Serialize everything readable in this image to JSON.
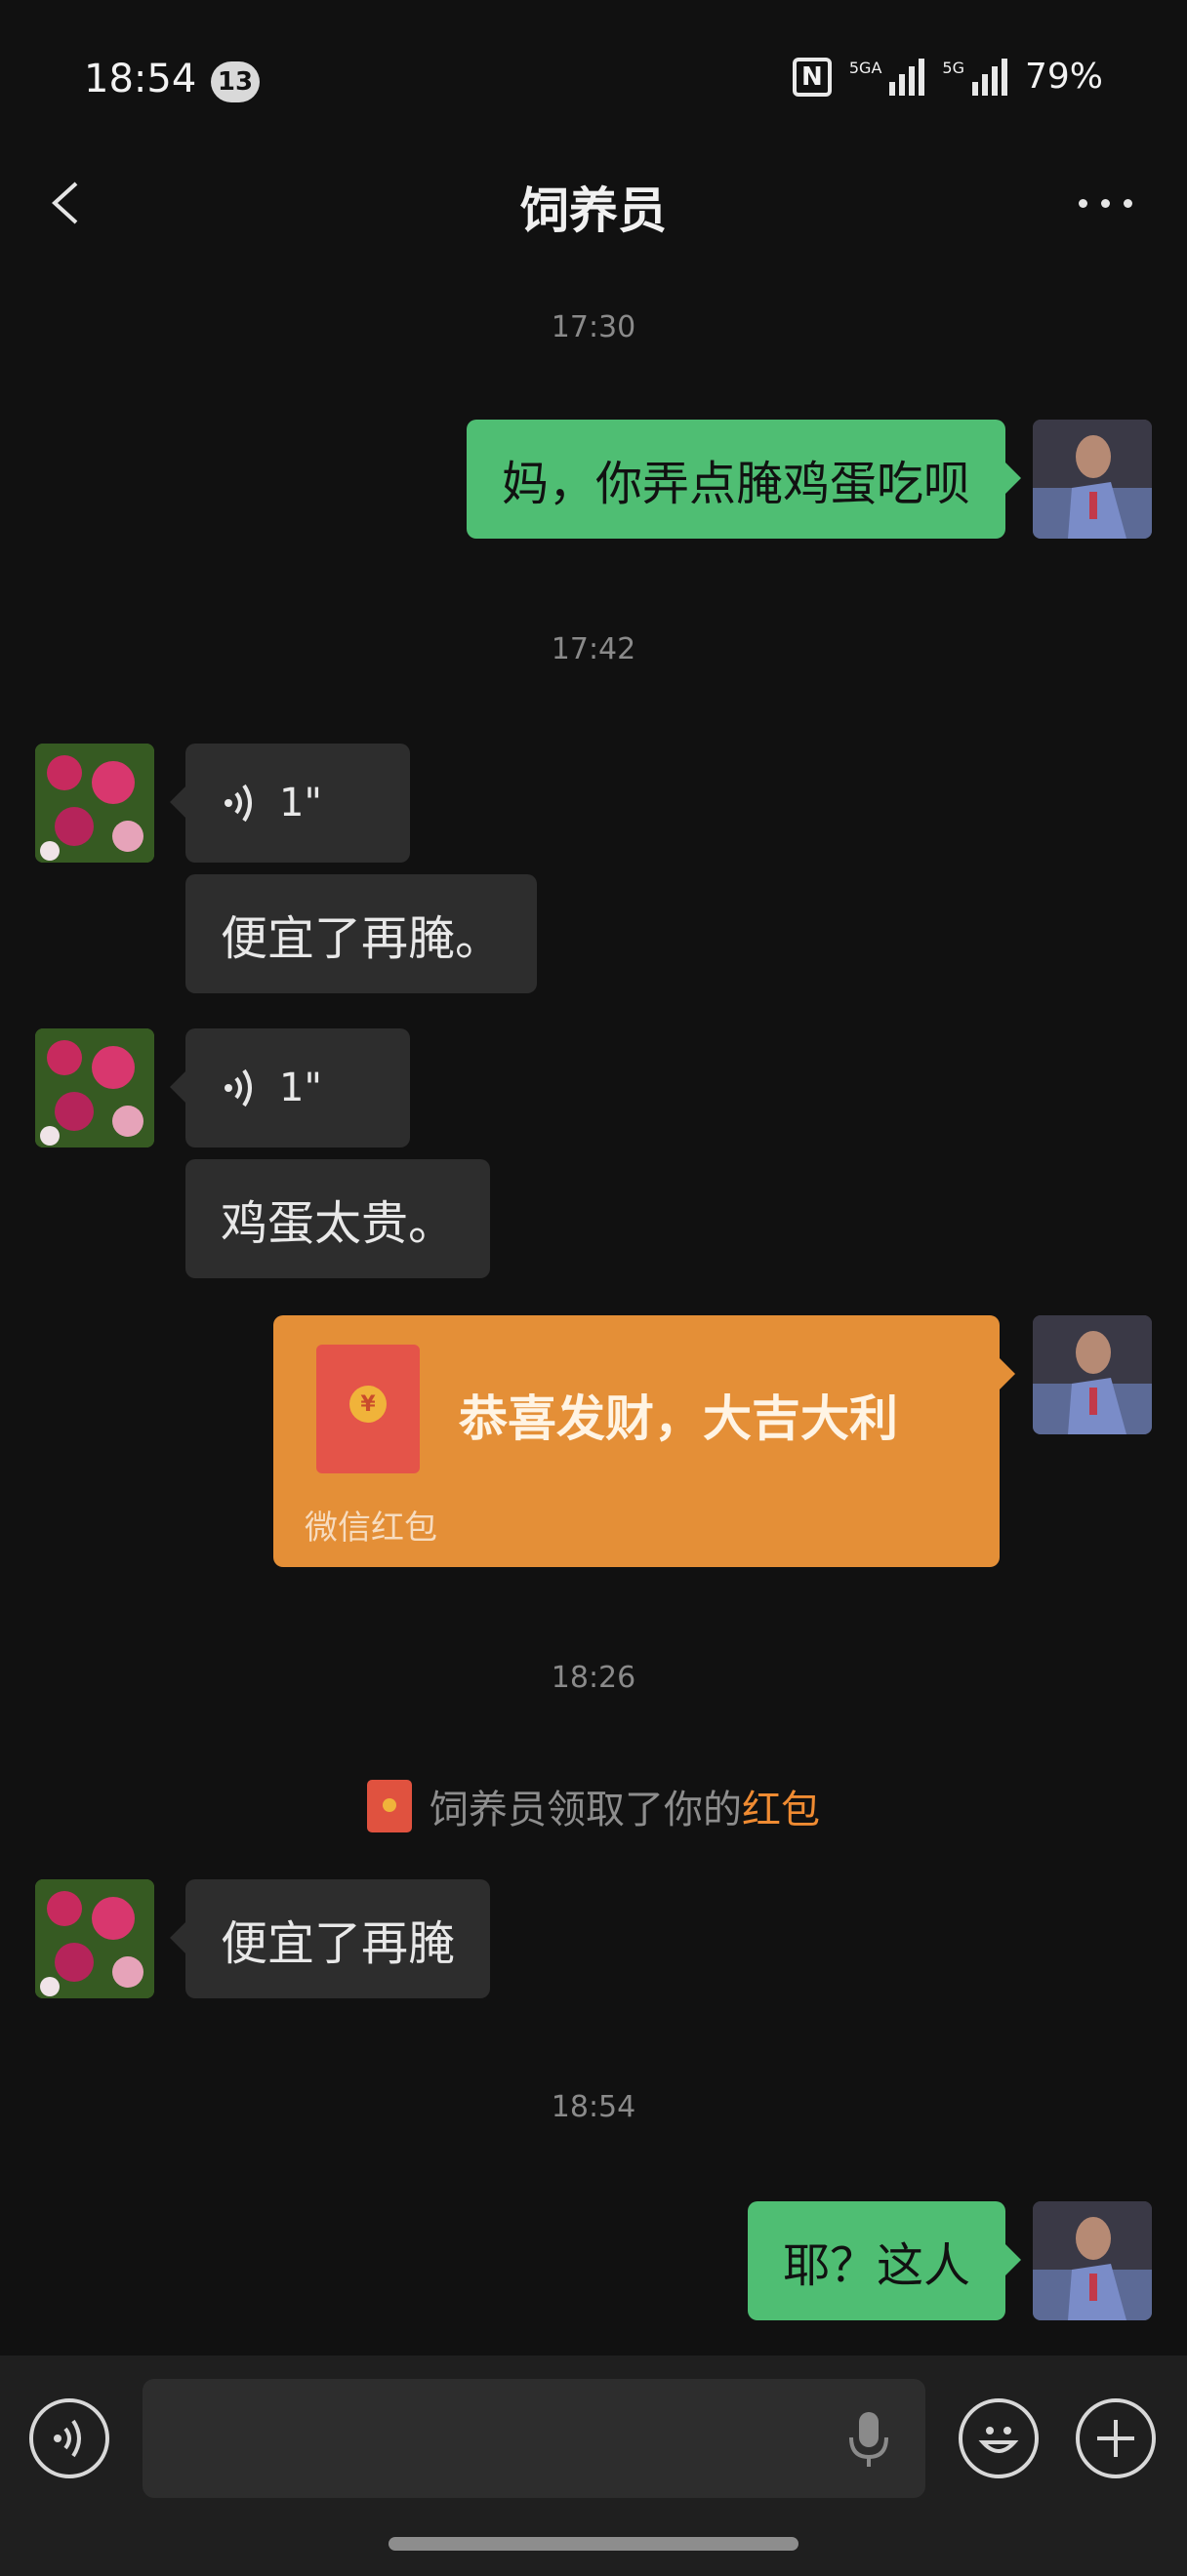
{
  "status_bar": {
    "time": "18:54",
    "notification_count": "13",
    "nfc": "N",
    "net1": "5GA",
    "net2": "5G",
    "battery": "79%"
  },
  "header": {
    "title": "饲养员"
  },
  "timestamps": [
    "17:30",
    "17:42",
    "18:26",
    "18:54"
  ],
  "messages": {
    "m1": "妈，你弄点腌鸡蛋吃呗",
    "voice1": "1\"",
    "m2": "便宜了再腌。",
    "voice2": "1\"",
    "m3": "鸡蛋太贵。",
    "m4": "便宜了再腌",
    "m5": "耶？这人"
  },
  "red_packet": {
    "title": "恭喜发财，大吉大利",
    "label": "微信红包",
    "coin": "¥"
  },
  "system_notice": {
    "text": "饲养员领取了你的",
    "link": "红包"
  },
  "input_bar": {
    "value": ""
  },
  "colors": {
    "sent_bubble": "#4fbe73",
    "received_bubble": "#2d2d2d",
    "red_packet": "#e48f37",
    "link": "#ef8b32"
  }
}
